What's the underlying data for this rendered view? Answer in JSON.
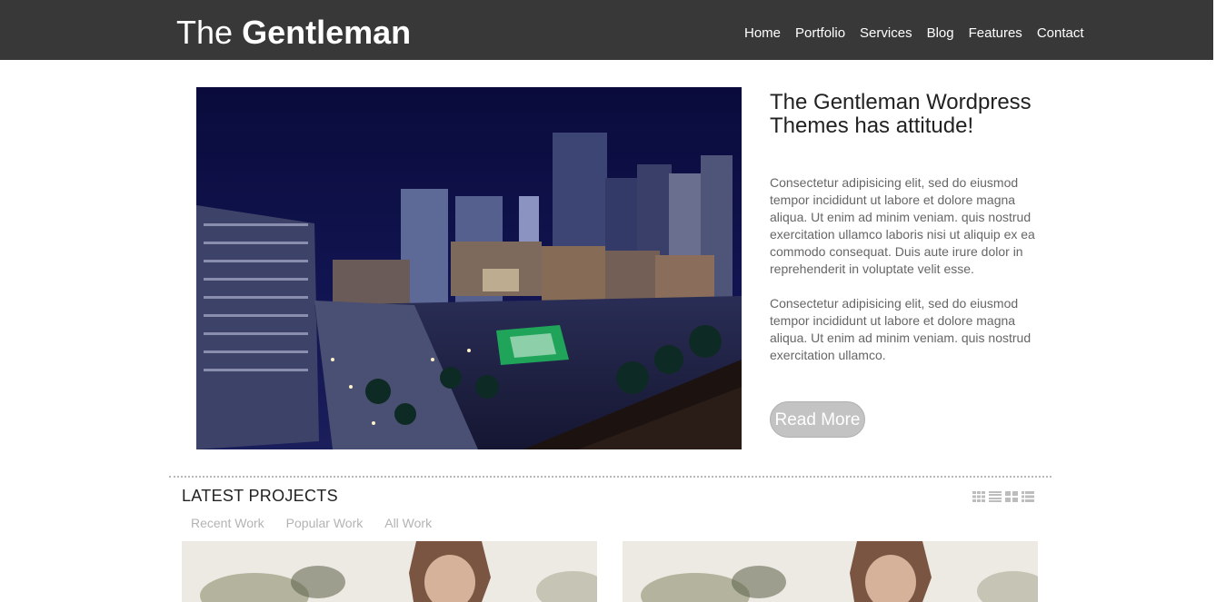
{
  "header": {
    "logo_light": "The",
    "logo_bold": "Gentleman",
    "nav": [
      "Home",
      "Portfolio",
      "Services",
      "Blog",
      "Features",
      "Contact"
    ]
  },
  "hero": {
    "title": "The Gentleman Wordpress Themes has attitude!",
    "paragraph1": "Consectetur adipisicing elit, sed do eiusmod tempor incididunt ut labore et dolore magna aliqua. Ut enim ad minim veniam. quis nostrud exercitation ullamco laboris nisi ut aliquip ex ea commodo consequat. Duis aute irure dolor in reprehenderit in voluptate velit esse.",
    "paragraph2": "Consectetur adipisicing elit, sed do eiusmod tempor incididunt ut labore et dolore magna aliqua. Ut enim ad minim veniam. quis nostrud exercitation ullamco.",
    "button_label": "Read More"
  },
  "projects": {
    "title": "LATEST PROJECTS",
    "filters": [
      "Recent Work",
      "Popular Work",
      "All Work"
    ],
    "view_icons": [
      "grid-large-icon",
      "list-detail-icon",
      "grid-small-icon",
      "list-icon"
    ]
  },
  "colors": {
    "header_bg": "#383838",
    "button_bg": "#c3c3c3",
    "filter_text": "#b3b3b3"
  }
}
